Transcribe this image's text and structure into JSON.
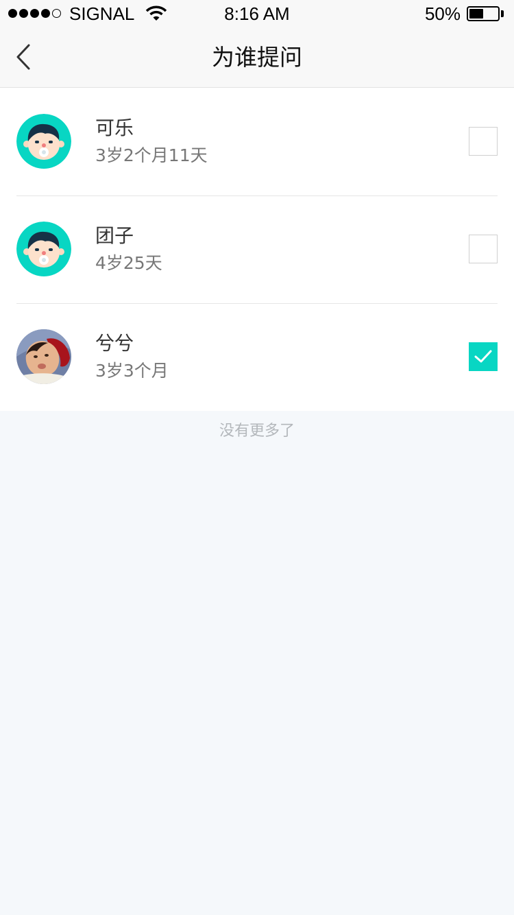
{
  "status_bar": {
    "carrier": "SIGNAL",
    "time": "8:16 AM",
    "battery_percent": "50%",
    "battery_level": 0.5,
    "signal_bars_filled": 4,
    "signal_bars_total": 5,
    "icons": [
      "signal-dots-icon",
      "wifi-icon",
      "battery-icon"
    ]
  },
  "nav": {
    "title": "为谁提问",
    "back_icon": "chevron-left-icon"
  },
  "children": [
    {
      "name": "可乐",
      "age": "3岁2个月11天",
      "avatar": "cartoon-baby-avatar",
      "checked": false
    },
    {
      "name": "团子",
      "age": "4岁25天",
      "avatar": "cartoon-baby-avatar",
      "checked": false
    },
    {
      "name": "兮兮",
      "age": "3岁3个月",
      "avatar": "photo-avatar",
      "checked": true
    }
  ],
  "footer": {
    "note": "没有更多了"
  },
  "colors": {
    "accent": "#08d6c3",
    "page_background": "#f5f8fb",
    "bar_background": "#f8f8f8",
    "secondary_text": "#777777",
    "footer_text": "#b3b7bb"
  }
}
